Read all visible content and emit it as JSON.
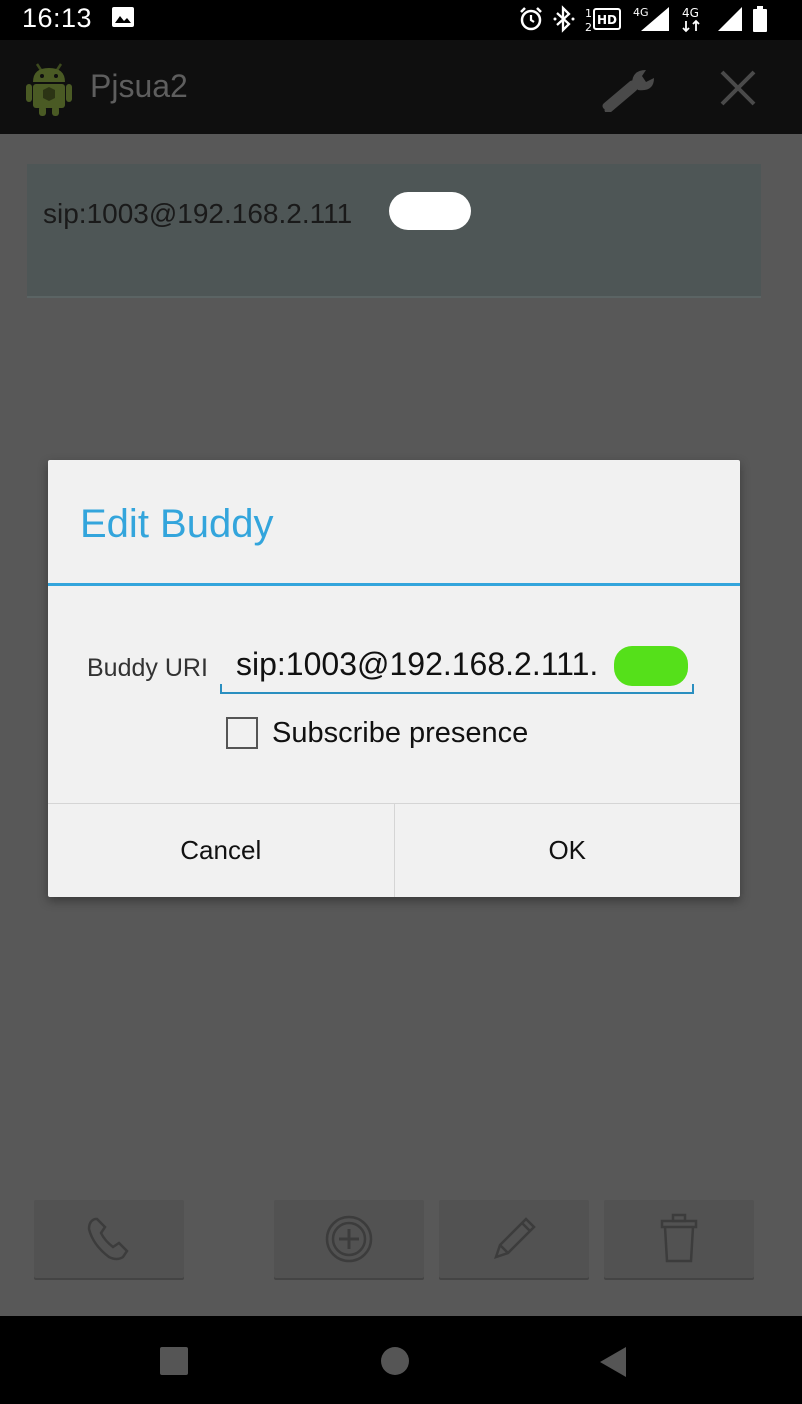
{
  "status_bar": {
    "time": "16:13",
    "icons": [
      "image-icon",
      "alarm-icon",
      "bluetooth-icon",
      "hd-voice-icon",
      "signal-4g-icon",
      "signal-4g-arrows-icon",
      "signal-icon",
      "battery-icon"
    ],
    "hd_label": "HD",
    "net1_label": "4G",
    "net2_label": "4G"
  },
  "app_bar": {
    "title": "Pjsua2",
    "icons": [
      "android-robot-icon",
      "wrench-icon",
      "close-icon"
    ]
  },
  "buddy_list": {
    "items": [
      {
        "uri": "sip:1003@192.168.2.111"
      }
    ]
  },
  "dialog": {
    "title": "Edit Buddy",
    "field_label": "Buddy URI",
    "uri_value": "sip:1003@192.168.2.111.",
    "checkbox_label": "Subscribe presence",
    "checkbox_checked": false,
    "cancel_label": "Cancel",
    "ok_label": "OK"
  },
  "toolbar": {
    "icons": [
      "phone-icon",
      "add-circle-icon",
      "pencil-icon",
      "trash-icon"
    ]
  },
  "nav_bar": {
    "icons": [
      "recents-square-icon",
      "home-circle-icon",
      "back-triangle-icon"
    ]
  },
  "colors": {
    "accent": "#33a5dc",
    "scrim": "#585858",
    "redaction_green": "#55e01a"
  }
}
